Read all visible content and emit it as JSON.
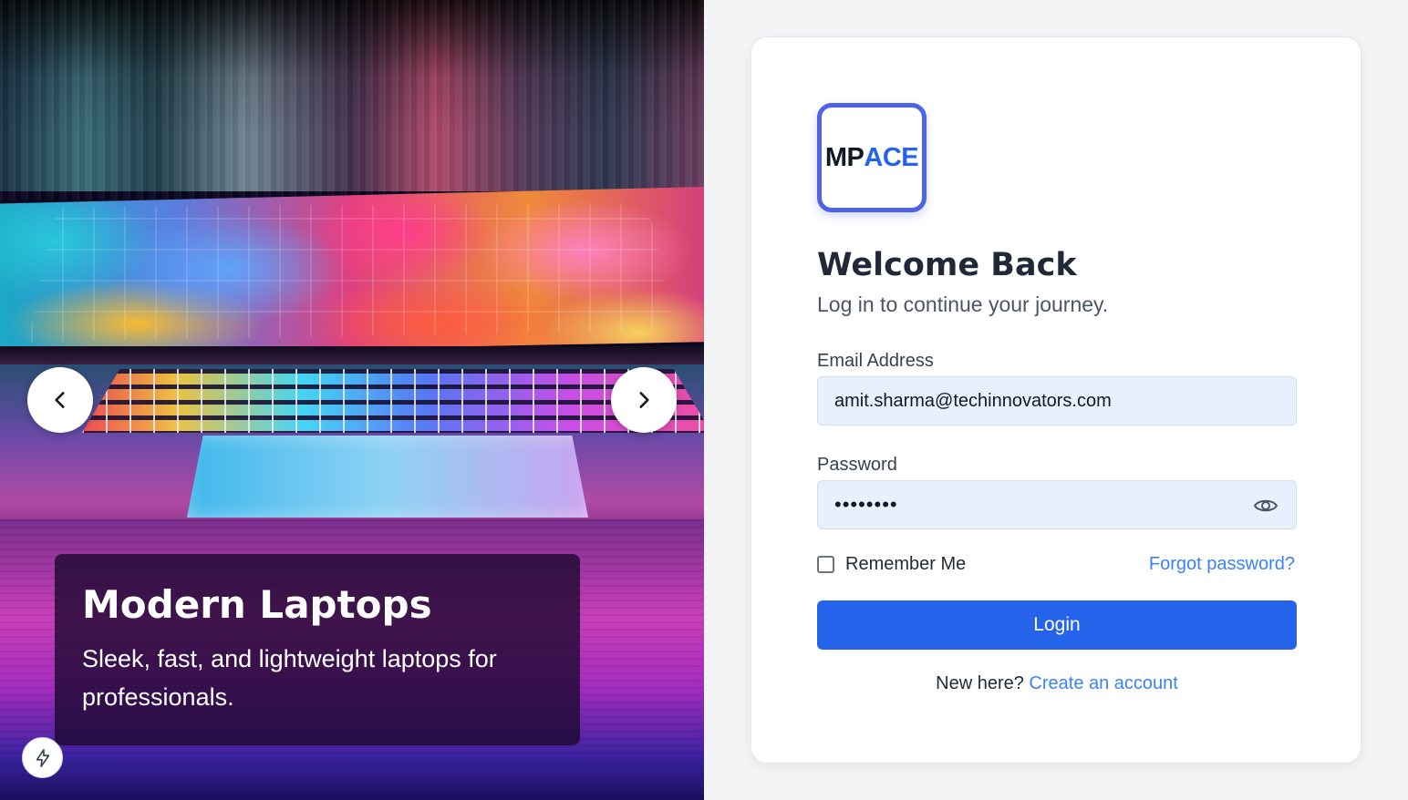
{
  "slide": {
    "title": "Modern Laptops",
    "description": "Sleek, fast, and lightweight laptops for professionals."
  },
  "carousel": {
    "prev_icon": "chevron-left-icon",
    "next_icon": "chevron-right-icon"
  },
  "floating_button": {
    "icon": "lightning-bolt-icon"
  },
  "logo": {
    "part1": "MP",
    "part2": "ACE"
  },
  "login": {
    "title": "Welcome Back",
    "subtitle": "Log in to continue your journey.",
    "email_label": "Email Address",
    "email_value": "amit.sharma@techinnovators.com",
    "password_label": "Password",
    "password_masked": "••••••••",
    "remember_label": "Remember Me",
    "remember_checked": false,
    "forgot_link": "Forgot password?",
    "login_button": "Login",
    "signup_prompt": "New here?",
    "signup_link": "Create an account"
  },
  "colors": {
    "primary": "#2563eb",
    "link": "#3b82f6",
    "input_bg": "#e8f0fe",
    "logo_border": "#4f63e6",
    "page_bg": "#f3f4f6"
  }
}
